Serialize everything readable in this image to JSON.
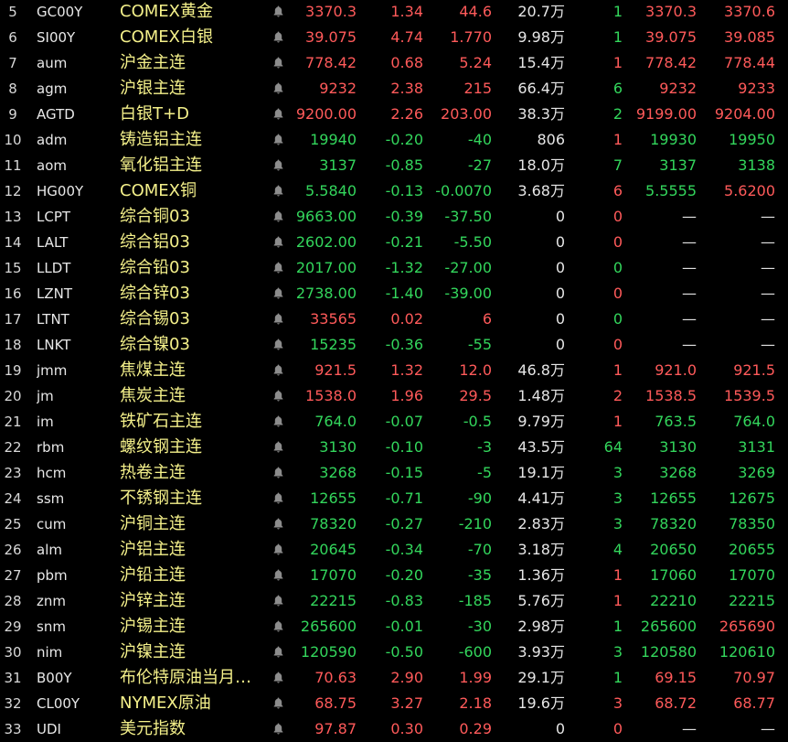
{
  "colors": {
    "up": "#ff5a5a",
    "down": "#33d65c",
    "name": "#f4f08a",
    "background": "#000000"
  },
  "rows": [
    {
      "idx": "5",
      "code": "GC00Y",
      "name": "COMEX黄金",
      "price": "3370.3",
      "pct": "1.34",
      "chg": "44.6",
      "vol": "20.7",
      "unit": "万",
      "cur": "1",
      "bid": "3370.3",
      "ask": "3370.6",
      "dir": "up",
      "curdir": "down",
      "biddir": "up",
      "askdir": "up"
    },
    {
      "idx": "6",
      "code": "SI00Y",
      "name": "COMEX白银",
      "price": "39.075",
      "pct": "4.74",
      "chg": "1.770",
      "vol": "9.98",
      "unit": "万",
      "cur": "1",
      "bid": "39.075",
      "ask": "39.085",
      "dir": "up",
      "curdir": "down",
      "biddir": "up",
      "askdir": "up"
    },
    {
      "idx": "7",
      "code": "aum",
      "name": "沪金主连",
      "price": "778.42",
      "pct": "0.68",
      "chg": "5.24",
      "vol": "15.4",
      "unit": "万",
      "cur": "1",
      "bid": "778.42",
      "ask": "778.44",
      "dir": "up",
      "curdir": "up",
      "biddir": "up",
      "askdir": "up"
    },
    {
      "idx": "8",
      "code": "agm",
      "name": "沪银主连",
      "price": "9232",
      "pct": "2.38",
      "chg": "215",
      "vol": "66.4",
      "unit": "万",
      "cur": "6",
      "bid": "9232",
      "ask": "9233",
      "dir": "up",
      "curdir": "down",
      "biddir": "up",
      "askdir": "up"
    },
    {
      "idx": "9",
      "code": "AGTD",
      "name": "白银T+D",
      "price": "9200.00",
      "pct": "2.26",
      "chg": "203.00",
      "vol": "38.3",
      "unit": "万",
      "cur": "2",
      "bid": "9199.00",
      "ask": "9204.00",
      "dir": "up",
      "curdir": "down",
      "biddir": "up",
      "askdir": "up"
    },
    {
      "idx": "10",
      "code": "adm",
      "name": "铸造铝主连",
      "price": "19940",
      "pct": "-0.20",
      "chg": "-40",
      "vol": "806",
      "unit": "",
      "cur": "1",
      "bid": "19930",
      "ask": "19950",
      "dir": "down",
      "curdir": "up",
      "biddir": "down",
      "askdir": "down"
    },
    {
      "idx": "11",
      "code": "aom",
      "name": "氧化铝主连",
      "price": "3137",
      "pct": "-0.85",
      "chg": "-27",
      "vol": "18.0",
      "unit": "万",
      "cur": "7",
      "bid": "3137",
      "ask": "3138",
      "dir": "down",
      "curdir": "down",
      "biddir": "down",
      "askdir": "down"
    },
    {
      "idx": "12",
      "code": "HG00Y",
      "name": "COMEX铜",
      "price": "5.5840",
      "pct": "-0.13",
      "chg": "-0.0070",
      "vol": "3.68",
      "unit": "万",
      "cur": "6",
      "bid": "5.5555",
      "ask": "5.6200",
      "dir": "down",
      "curdir": "up",
      "biddir": "down",
      "askdir": "up"
    },
    {
      "idx": "13",
      "code": "LCPT",
      "name": "综合铜03",
      "price": "9663.00",
      "pct": "-0.39",
      "chg": "-37.50",
      "vol": "0",
      "unit": "",
      "cur": "0",
      "bid": "—",
      "ask": "—",
      "dir": "down",
      "curdir": "up",
      "biddir": "dash",
      "askdir": "dash"
    },
    {
      "idx": "14",
      "code": "LALT",
      "name": "综合铝03",
      "price": "2602.00",
      "pct": "-0.21",
      "chg": "-5.50",
      "vol": "0",
      "unit": "",
      "cur": "0",
      "bid": "—",
      "ask": "—",
      "dir": "down",
      "curdir": "up",
      "biddir": "dash",
      "askdir": "dash"
    },
    {
      "idx": "15",
      "code": "LLDT",
      "name": "综合铅03",
      "price": "2017.00",
      "pct": "-1.32",
      "chg": "-27.00",
      "vol": "0",
      "unit": "",
      "cur": "0",
      "bid": "—",
      "ask": "—",
      "dir": "down",
      "curdir": "down",
      "biddir": "dash",
      "askdir": "dash"
    },
    {
      "idx": "16",
      "code": "LZNT",
      "name": "综合锌03",
      "price": "2738.00",
      "pct": "-1.40",
      "chg": "-39.00",
      "vol": "0",
      "unit": "",
      "cur": "0",
      "bid": "—",
      "ask": "—",
      "dir": "down",
      "curdir": "up",
      "biddir": "dash",
      "askdir": "dash"
    },
    {
      "idx": "17",
      "code": "LTNT",
      "name": "综合锡03",
      "price": "33565",
      "pct": "0.02",
      "chg": "6",
      "vol": "0",
      "unit": "",
      "cur": "0",
      "bid": "—",
      "ask": "—",
      "dir": "up",
      "curdir": "down",
      "biddir": "dash",
      "askdir": "dash"
    },
    {
      "idx": "18",
      "code": "LNKT",
      "name": "综合镍03",
      "price": "15235",
      "pct": "-0.36",
      "chg": "-55",
      "vol": "0",
      "unit": "",
      "cur": "0",
      "bid": "—",
      "ask": "—",
      "dir": "down",
      "curdir": "up",
      "biddir": "dash",
      "askdir": "dash"
    },
    {
      "idx": "19",
      "code": "jmm",
      "name": "焦煤主连",
      "price": "921.5",
      "pct": "1.32",
      "chg": "12.0",
      "vol": "46.8",
      "unit": "万",
      "cur": "1",
      "bid": "921.0",
      "ask": "921.5",
      "dir": "up",
      "curdir": "up",
      "biddir": "up",
      "askdir": "up"
    },
    {
      "idx": "20",
      "code": "jm",
      "name": "焦炭主连",
      "price": "1538.0",
      "pct": "1.96",
      "chg": "29.5",
      "vol": "1.48",
      "unit": "万",
      "cur": "2",
      "bid": "1538.5",
      "ask": "1539.5",
      "dir": "up",
      "curdir": "up",
      "biddir": "up",
      "askdir": "up"
    },
    {
      "idx": "21",
      "code": "im",
      "name": "铁矿石主连",
      "price": "764.0",
      "pct": "-0.07",
      "chg": "-0.5",
      "vol": "9.79",
      "unit": "万",
      "cur": "1",
      "bid": "763.5",
      "ask": "764.0",
      "dir": "down",
      "curdir": "up",
      "biddir": "down",
      "askdir": "down"
    },
    {
      "idx": "22",
      "code": "rbm",
      "name": "螺纹钢主连",
      "price": "3130",
      "pct": "-0.10",
      "chg": "-3",
      "vol": "43.5",
      "unit": "万",
      "cur": "64",
      "bid": "3130",
      "ask": "3131",
      "dir": "down",
      "curdir": "down",
      "biddir": "down",
      "askdir": "down"
    },
    {
      "idx": "23",
      "code": "hcm",
      "name": "热卷主连",
      "price": "3268",
      "pct": "-0.15",
      "chg": "-5",
      "vol": "19.1",
      "unit": "万",
      "cur": "3",
      "bid": "3268",
      "ask": "3269",
      "dir": "down",
      "curdir": "down",
      "biddir": "down",
      "askdir": "down"
    },
    {
      "idx": "24",
      "code": "ssm",
      "name": "不锈钢主连",
      "price": "12655",
      "pct": "-0.71",
      "chg": "-90",
      "vol": "4.41",
      "unit": "万",
      "cur": "3",
      "bid": "12655",
      "ask": "12675",
      "dir": "down",
      "curdir": "down",
      "biddir": "down",
      "askdir": "down"
    },
    {
      "idx": "25",
      "code": "cum",
      "name": "沪铜主连",
      "price": "78320",
      "pct": "-0.27",
      "chg": "-210",
      "vol": "2.83",
      "unit": "万",
      "cur": "3",
      "bid": "78320",
      "ask": "78350",
      "dir": "down",
      "curdir": "down",
      "biddir": "down",
      "askdir": "down"
    },
    {
      "idx": "26",
      "code": "alm",
      "name": "沪铝主连",
      "price": "20645",
      "pct": "-0.34",
      "chg": "-70",
      "vol": "3.18",
      "unit": "万",
      "cur": "4",
      "bid": "20650",
      "ask": "20655",
      "dir": "down",
      "curdir": "down",
      "biddir": "down",
      "askdir": "down"
    },
    {
      "idx": "27",
      "code": "pbm",
      "name": "沪铅主连",
      "price": "17070",
      "pct": "-0.20",
      "chg": "-35",
      "vol": "1.36",
      "unit": "万",
      "cur": "1",
      "bid": "17060",
      "ask": "17070",
      "dir": "down",
      "curdir": "up",
      "biddir": "down",
      "askdir": "down"
    },
    {
      "idx": "28",
      "code": "znm",
      "name": "沪锌主连",
      "price": "22215",
      "pct": "-0.83",
      "chg": "-185",
      "vol": "5.76",
      "unit": "万",
      "cur": "1",
      "bid": "22210",
      "ask": "22215",
      "dir": "down",
      "curdir": "up",
      "biddir": "down",
      "askdir": "down"
    },
    {
      "idx": "29",
      "code": "snm",
      "name": "沪锡主连",
      "price": "265600",
      "pct": "-0.01",
      "chg": "-30",
      "vol": "2.98",
      "unit": "万",
      "cur": "1",
      "bid": "265600",
      "ask": "265690",
      "dir": "down",
      "curdir": "down",
      "biddir": "down",
      "askdir": "up"
    },
    {
      "idx": "30",
      "code": "nim",
      "name": "沪镍主连",
      "price": "120590",
      "pct": "-0.50",
      "chg": "-600",
      "vol": "3.93",
      "unit": "万",
      "cur": "3",
      "bid": "120580",
      "ask": "120610",
      "dir": "down",
      "curdir": "down",
      "biddir": "down",
      "askdir": "down"
    },
    {
      "idx": "31",
      "code": "B00Y",
      "name": "布伦特原油当月…",
      "price": "70.63",
      "pct": "2.90",
      "chg": "1.99",
      "vol": "29.1",
      "unit": "万",
      "cur": "1",
      "bid": "69.15",
      "ask": "70.97",
      "dir": "up",
      "curdir": "down",
      "biddir": "up",
      "askdir": "up"
    },
    {
      "idx": "32",
      "code": "CL00Y",
      "name": "NYMEX原油",
      "price": "68.75",
      "pct": "3.27",
      "chg": "2.18",
      "vol": "19.6",
      "unit": "万",
      "cur": "3",
      "bid": "68.72",
      "ask": "68.77",
      "dir": "up",
      "curdir": "up",
      "biddir": "up",
      "askdir": "up"
    },
    {
      "idx": "33",
      "code": "UDI",
      "name": "美元指数",
      "price": "97.87",
      "pct": "0.30",
      "chg": "0.29",
      "vol": "0",
      "unit": "",
      "cur": "0",
      "bid": "—",
      "ask": "—",
      "dir": "up",
      "curdir": "up",
      "biddir": "dash",
      "askdir": "dash"
    }
  ]
}
